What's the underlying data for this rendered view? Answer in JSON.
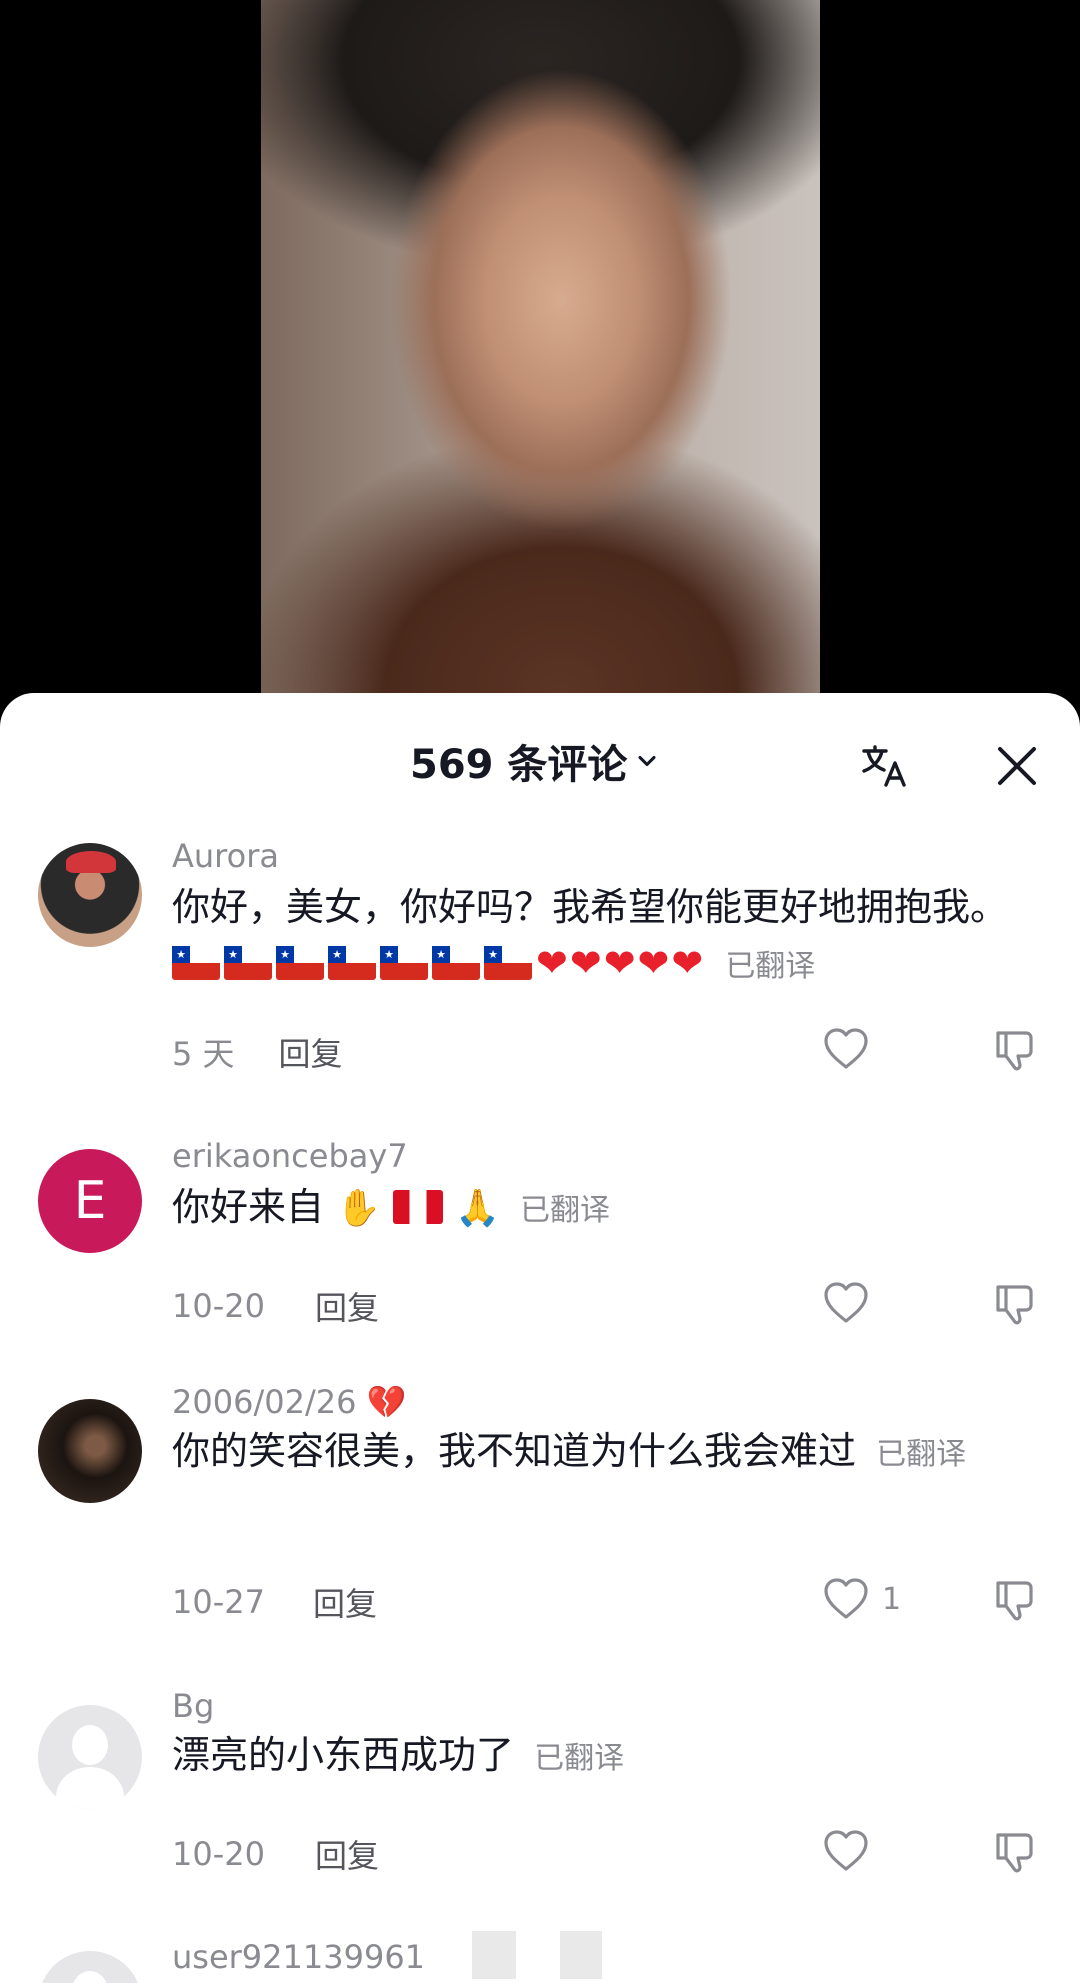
{
  "header": {
    "comment_count": "569 条评论"
  },
  "comments": [
    {
      "username": "Aurora",
      "text": "你好，美女，你好吗？我希望你能更好地拥抱我。",
      "translated_label": "已翻译",
      "time": "5 天",
      "reply_label": "回复",
      "likes": ""
    },
    {
      "username": "erikaoncebay7",
      "avatar_letter": "E",
      "text": "你好来自",
      "translated_label": "已翻译",
      "time": "10-20",
      "reply_label": "回复",
      "likes": ""
    },
    {
      "username": "2006/02/26",
      "text": "你的笑容很美，我不知道为什么我会难过",
      "translated_label": "已翻译",
      "time": "10-27",
      "reply_label": "回复",
      "likes": "1"
    },
    {
      "username": "Bg",
      "text": "漂亮的小东西成功了",
      "translated_label": "已翻译",
      "time": "10-20",
      "reply_label": "回复",
      "likes": ""
    },
    {
      "username": "user921139961"
    }
  ],
  "colors": {
    "accent_like": "#161823",
    "muted_text": "#8a8b91",
    "avatar_letter_bg": "#c8195b"
  }
}
